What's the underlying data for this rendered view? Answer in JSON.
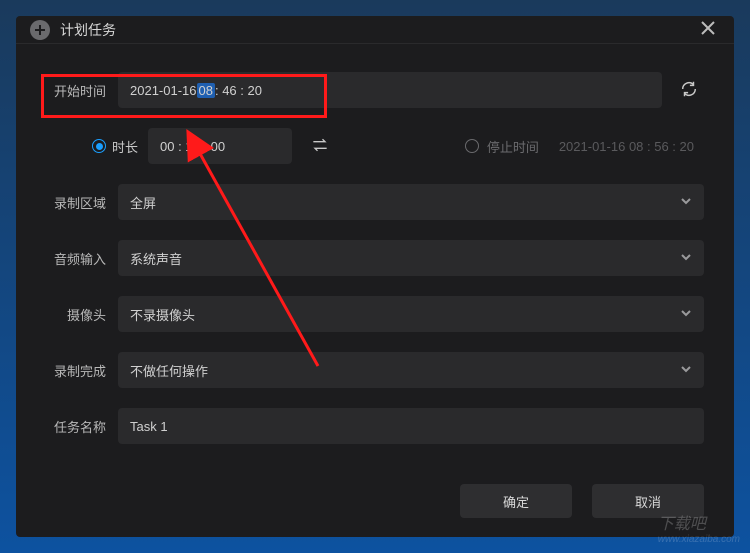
{
  "dialog": {
    "title": "计划任务"
  },
  "startTime": {
    "label": "开始时间",
    "datePart": "2021-01-16 ",
    "hourSelected": "08",
    "restPart": " : 46 : 20"
  },
  "durationRadio": {
    "label": "时长"
  },
  "duration": {
    "value": "00 : 10 : 00"
  },
  "stopRadio": {
    "label": "停止时间"
  },
  "stopTime": {
    "value": "2021-01-16 08 : 56 : 20"
  },
  "recordArea": {
    "label": "录制区域",
    "value": "全屏"
  },
  "audioInput": {
    "label": "音频输入",
    "value": "系统声音"
  },
  "camera": {
    "label": "摄像头",
    "value": "不录摄像头"
  },
  "onComplete": {
    "label": "录制完成",
    "value": "不做任何操作"
  },
  "taskName": {
    "label": "任务名称",
    "value": "Task 1"
  },
  "buttons": {
    "ok": "确定",
    "cancel": "取消"
  },
  "watermark": {
    "main": "下载吧",
    "sub": "www.xiazaiba.com"
  }
}
